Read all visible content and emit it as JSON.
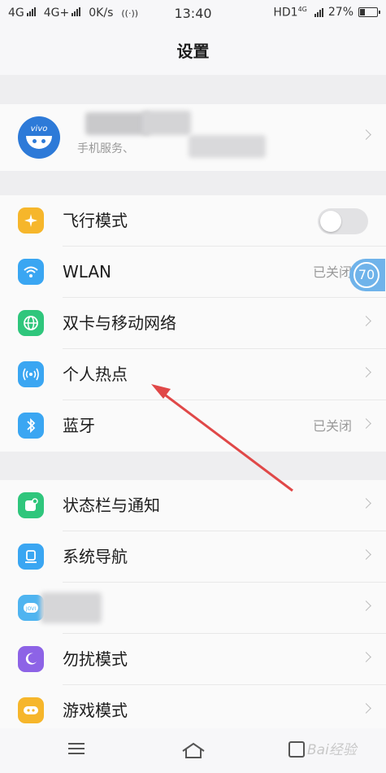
{
  "status_bar": {
    "network1": "4G",
    "network2": "4G+",
    "speed": "0K/s",
    "time": "13:40",
    "hd": "HD1",
    "hd_sup": "4G",
    "battery": "27%"
  },
  "page_title": "设置",
  "profile": {
    "subtitle": "手机服务、"
  },
  "group1": [
    {
      "label": "飞行模式",
      "icon": "airplane-icon",
      "color": "#f6b62b",
      "toggle": true
    },
    {
      "label": "WLAN",
      "icon": "wifi-icon",
      "color": "#3aa6f2",
      "value": "已关闭"
    },
    {
      "label": "双卡与移动网络",
      "icon": "globe-icon",
      "color": "#2fc67c"
    },
    {
      "label": "个人热点",
      "icon": "hotspot-icon",
      "color": "#3aa6f2"
    },
    {
      "label": "蓝牙",
      "icon": "bluetooth-icon",
      "color": "#3aa6f2",
      "value": "已关闭"
    }
  ],
  "group2": [
    {
      "label": "状态栏与通知",
      "icon": "notification-icon",
      "color": "#2fc67c"
    },
    {
      "label": "系统导航",
      "icon": "navigation-icon",
      "color": "#3aa6f2"
    },
    {
      "label": "",
      "icon": "jovi-icon",
      "color": "#4fb4f0"
    },
    {
      "label": "勿扰模式",
      "icon": "moon-icon",
      "color": "#8d63e6"
    },
    {
      "label": "游戏模式",
      "icon": "gamepad-icon",
      "color": "#f6b62b"
    }
  ],
  "float_ball": "70",
  "watermark": "Bai经验",
  "colors": {
    "accent_arrow": "#e04848"
  }
}
